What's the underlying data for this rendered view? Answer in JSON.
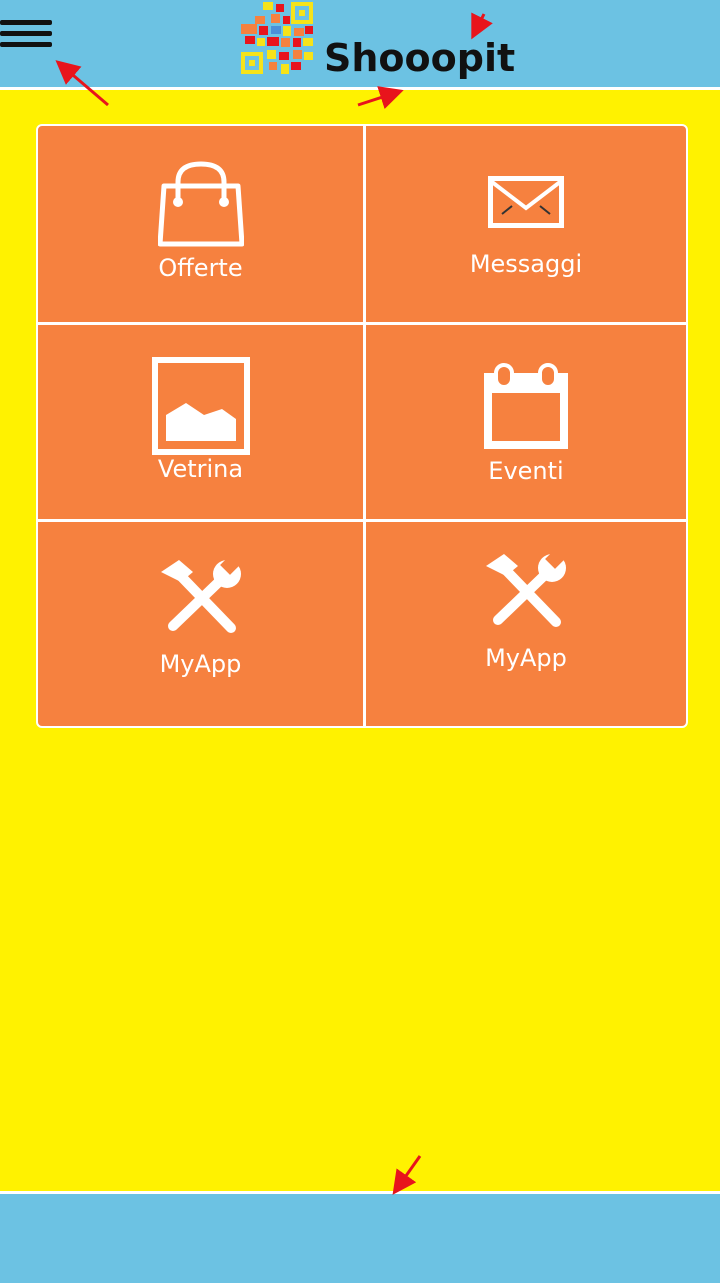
{
  "header": {
    "title": "Shooopit",
    "menu_icon": "hamburger-menu-icon",
    "logo_icon": "qr-code-logo-icon"
  },
  "tiles": [
    {
      "label": "Offerte",
      "icon": "shopping-bag-icon"
    },
    {
      "label": "Messaggi",
      "icon": "envelope-icon"
    },
    {
      "label": "Vetrina",
      "icon": "picture-icon"
    },
    {
      "label": "Eventi",
      "icon": "calendar-icon"
    },
    {
      "label": "MyApp",
      "icon": "tools-icon"
    },
    {
      "label": "MyApp",
      "icon": "tools-icon"
    }
  ],
  "colors": {
    "background": "#FFF200",
    "bars": "#6CC2E3",
    "tiles": "#F6813F",
    "annotation_arrows": "#E8141C"
  }
}
